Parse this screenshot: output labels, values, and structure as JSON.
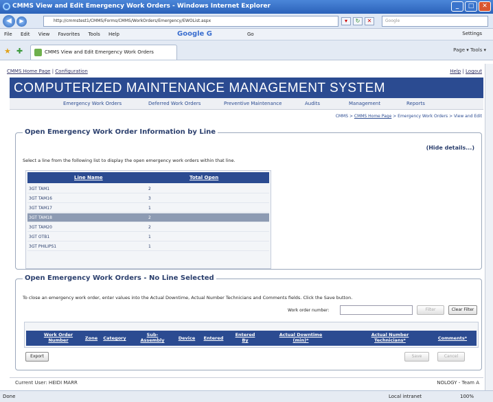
{
  "window": {
    "title": "CMMS View and Edit Emergency Work Orders - Windows Internet Explorer"
  },
  "browser": {
    "url": "http://cmmstest1/CMMS/Forms/CMMS/WorkOrders/Emergency/EWOList.aspx",
    "search_placeholder": "Google",
    "menu": [
      "File",
      "Edit",
      "View",
      "Favorites",
      "Tools",
      "Help"
    ],
    "google_label": "Google G",
    "go_label": "Go",
    "settings_label": "Settings",
    "tab_title": "CMMS View and Edit Emergency Work Orders",
    "toolbar": "Page ▾   Tools ▾"
  },
  "page": {
    "home_link": "CMMS Home Page",
    "config_link": "Configuration",
    "help_link": "Help",
    "logout_link": "Logout",
    "banner": "COMPUTERIZED MAINTENANCE MANAGEMENT SYSTEM",
    "nav": [
      "Emergency Work Orders",
      "Deferred Work Orders",
      "Preventive Maintenance",
      "Audits",
      "Management",
      "Reports"
    ],
    "breadcrumb": {
      "root": "CMMS",
      "home": "CMMS Home Page",
      "section": "Emergency Work Orders",
      "current": "View and Edit"
    }
  },
  "section1": {
    "title": "Open Emergency Work Order Information by Line",
    "hide": "(Hide details...)",
    "desc": "Select a line from the following list to display the open emergency work orders within that line.",
    "headers": [
      "Line Name",
      "Total Open"
    ],
    "rows": [
      {
        "name": "3GT TAM1",
        "open": "2"
      },
      {
        "name": "3GT TAM16",
        "open": "3"
      },
      {
        "name": "3GT TAM17",
        "open": "1"
      },
      {
        "name": "3GT TAM18",
        "open": "2"
      },
      {
        "name": "3GT TAM20",
        "open": "2"
      },
      {
        "name": "3GT OTB1",
        "open": "1"
      },
      {
        "name": "3GT PHILIPS1",
        "open": "1"
      }
    ]
  },
  "section2": {
    "title": "Open Emergency Work Orders - No Line Selected",
    "desc": "To close an emergency work order, enter values into the Actual Downtime, Actual Number Technicians and Comments fields. Click the Save button.",
    "wo_label": "Work order number:",
    "filter": "Filter",
    "clear_filter": "Clear Filter",
    "headers": [
      "Work Order Number",
      "Zone",
      "Category",
      "Sub-Assembly",
      "Device",
      "Entered",
      "Entered By",
      "Actual Downtime (min)*",
      "Actual Number Technicians*",
      "Comments*"
    ],
    "export": "Export",
    "save": "Save",
    "cancel": "Cancel"
  },
  "footer": {
    "user": "Current User: HEIDI MARR",
    "team": "NOLOGY - Team A"
  },
  "status": {
    "left": "Done",
    "zone": "Local intranet",
    "zoom": "100%"
  }
}
